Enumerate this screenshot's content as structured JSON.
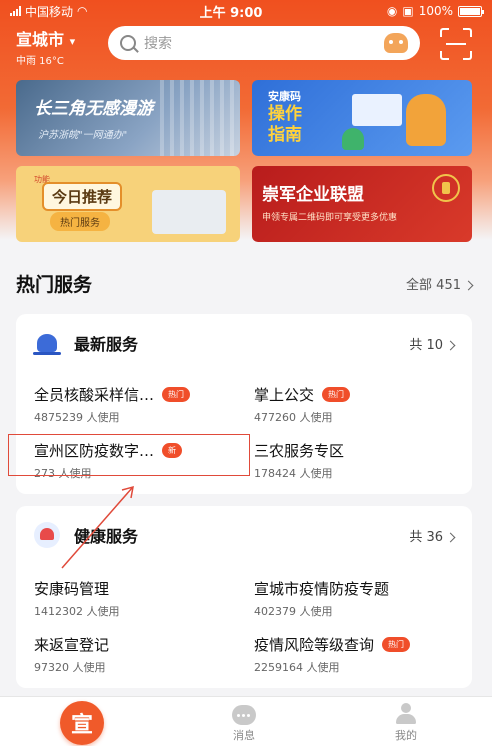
{
  "status_bar": {
    "carrier": "中国移动",
    "time": "上午 9:00",
    "battery": "100%"
  },
  "topbar": {
    "city": "宣城市",
    "weather": "中雨 16°C",
    "search_placeholder": "搜索"
  },
  "banners": [
    {
      "title": "长三角无感漫游",
      "subtitle": "沪苏浙皖\"一网通办\""
    },
    {
      "title_small": "安康码",
      "title_big": "操作指南"
    },
    {
      "tag": "功能",
      "title": "今日推荐",
      "subtitle": "热门服务"
    },
    {
      "title": "崇军企业联盟",
      "subtitle": "申领专属二维码即可享受更多优惠"
    }
  ],
  "hot_services": {
    "title": "热门服务",
    "more": "全部 451"
  },
  "card_latest": {
    "title": "最新服务",
    "count": "共 10",
    "items": [
      {
        "name": "全员核酸采样信…",
        "badge": "热门",
        "users": "4875239 人使用"
      },
      {
        "name": "掌上公交",
        "badge": "热门",
        "users": "477260 人使用"
      },
      {
        "name": "宣州区防疫数字…",
        "badge": "新",
        "users": "273 人使用"
      },
      {
        "name": "三农服务专区",
        "badge": "",
        "users": "178424 人使用"
      }
    ]
  },
  "card_health": {
    "title": "健康服务",
    "count": "共 36",
    "items": [
      {
        "name": "安康码管理",
        "badge": "",
        "users": "1412302 人使用"
      },
      {
        "name": "宣城市疫情防疫专题",
        "badge": "",
        "users": "402379 人使用"
      },
      {
        "name": "来返宣登记",
        "badge": "",
        "users": "97320 人使用"
      },
      {
        "name": "疫情风险等级查询",
        "badge": "热门",
        "users": "2259164 人使用"
      }
    ]
  },
  "tabbar": {
    "home_glyph": "宣",
    "message": "消息",
    "mine": "我的"
  },
  "colors": {
    "brand": "#f05a2a",
    "badge": "#f04e2a",
    "highlight": "#e04a3a"
  }
}
